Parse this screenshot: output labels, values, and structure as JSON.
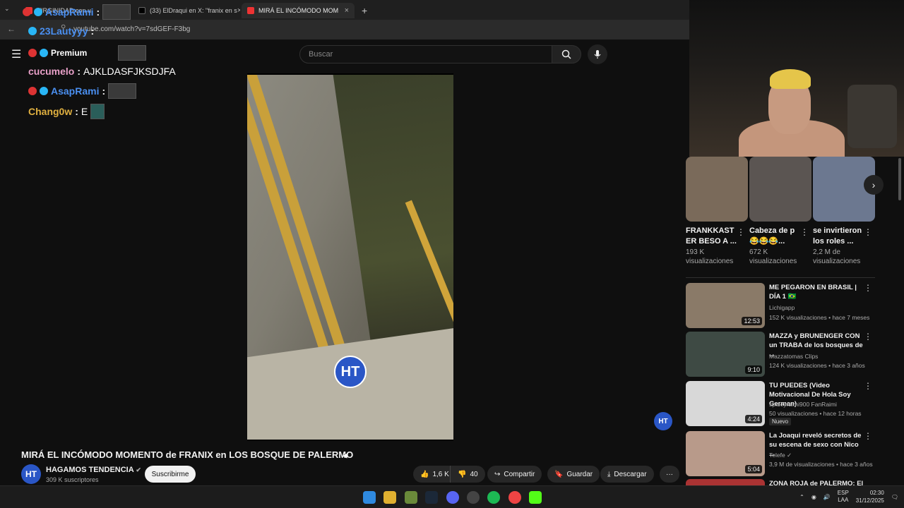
{
  "browser": {
    "tabs": [
      {
        "label": "VIRGINIDAD con u",
        "active": false
      },
      {
        "label": "(33) ElDraqui en X: \"franix en s",
        "active": false
      },
      {
        "label": "MIRÁ EL INCÓMODO MOM",
        "active": true
      }
    ],
    "url": "youtube.com/watch?v=7sdGEF-F3bg",
    "new_tab": "+",
    "close": "×"
  },
  "youtube": {
    "search_placeholder": "Buscar",
    "video_title": "MIRÁ EL INCÓMODO MOMENTO de FRANIX en LOS BOSQUE DE PALERMO",
    "channel_name": "HAGAMOS TENDENCIA",
    "channel_subs": "309 K suscriptores",
    "subscribe": "Suscribirme",
    "likes": "1,6 K",
    "dislikes": "40",
    "share": "Compartir",
    "save": "Guardar",
    "download": "Descargar",
    "more": "···",
    "logo_text": "HT"
  },
  "chat": [
    {
      "user": "Premium",
      "text": "",
      "color": "#ffffff"
    },
    {
      "user": "cucumelo",
      "text": "AJKLDASFJKSDJFA",
      "color": "#e8a0c8"
    },
    {
      "user": "AsapRami",
      "text": "",
      "color": "#4a8ff0"
    },
    {
      "user": "Chang0w",
      "text": "E",
      "color": "#e0b040"
    }
  ],
  "chat_overlay_top": [
    {
      "user": "AsapRami",
      "color": "#4a8ff0"
    },
    {
      "user": "23Lautyyy",
      "color": "#4a8ff0"
    }
  ],
  "shorts": [
    {
      "title": "FRANKKAST ER BESO A ...",
      "views": "193 K visualizaciones"
    },
    {
      "title": "Cabeza de p 😂😂😂...",
      "views": "672 K visualizaciones"
    },
    {
      "title": "se invirtieron los roles ...",
      "views": "2,2 M de visualizaciones"
    }
  ],
  "recommended": [
    {
      "title": "ME PEGARON EN BRASIL | DÍA 1 🇧🇷",
      "channel": "Lichigapp",
      "meta": "152 K visualizaciones • hace 7 meses",
      "duration": "12:53",
      "new": ""
    },
    {
      "title": "MAZZA y BRUNENGER CON un TRABA de los bosques de ...",
      "channel": "Mazzatomas Clips",
      "meta": "124 K visualizaciones • hace 3 años",
      "duration": "9:10",
      "new": ""
    },
    {
      "title": "TU PUEDES (Video Motivacional De Hola Soy German)",
      "channel": "spideyraimi900 FanRaimi",
      "meta": "50 visualizaciones • hace 12 horas",
      "duration": "4:24",
      "new": "Nuevo"
    },
    {
      "title": "La Joaqui reveló secretos de su escena de sexo con Nico ...",
      "channel": "Telefe ✓",
      "meta": "3,9 M de visualizaciones • hace 3 años",
      "duration": "5:04",
      "new": ""
    },
    {
      "title": "ZONA ROJA de PALERMO: El",
      "channel": "",
      "meta": "",
      "duration": "",
      "new": ""
    }
  ],
  "taskbar": {
    "lang": "ESP",
    "lang2": "LAA",
    "time": "02:30",
    "date": "31/12/2025"
  }
}
